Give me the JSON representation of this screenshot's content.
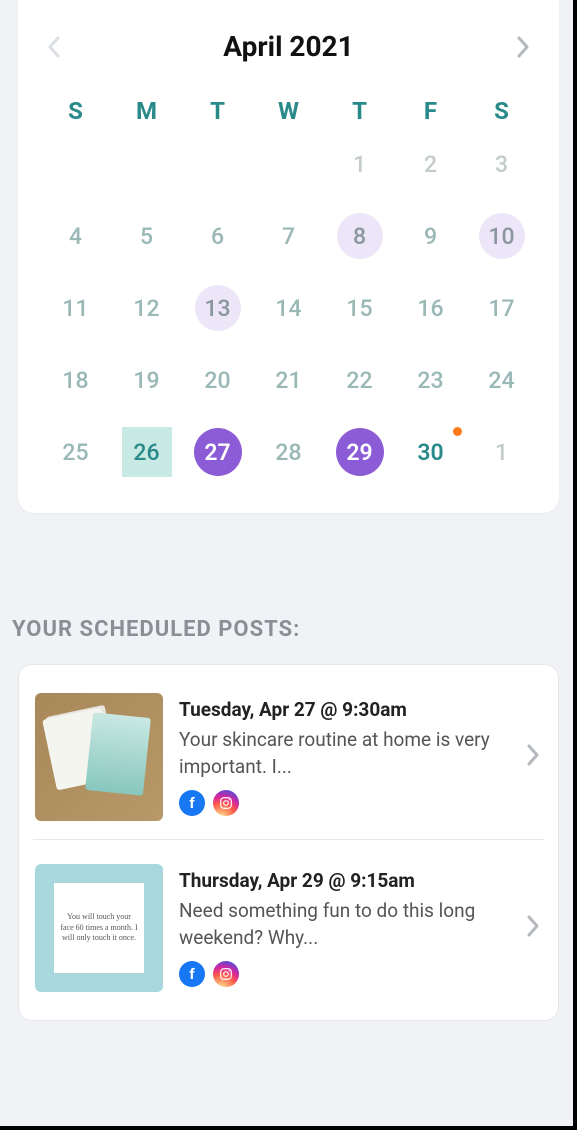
{
  "calendar": {
    "title": "April 2021",
    "weekdays": [
      "S",
      "M",
      "T",
      "W",
      "T",
      "F",
      "S"
    ],
    "cells": [
      {
        "n": "",
        "cls": ""
      },
      {
        "n": "",
        "cls": ""
      },
      {
        "n": "",
        "cls": ""
      },
      {
        "n": "",
        "cls": ""
      },
      {
        "n": "1",
        "cls": "prev-month"
      },
      {
        "n": "2",
        "cls": "prev-month"
      },
      {
        "n": "3",
        "cls": "prev-month"
      },
      {
        "n": "4",
        "cls": ""
      },
      {
        "n": "5",
        "cls": ""
      },
      {
        "n": "6",
        "cls": ""
      },
      {
        "n": "7",
        "cls": ""
      },
      {
        "n": "8",
        "cls": "light-purple"
      },
      {
        "n": "9",
        "cls": ""
      },
      {
        "n": "10",
        "cls": "light-purple"
      },
      {
        "n": "11",
        "cls": ""
      },
      {
        "n": "12",
        "cls": ""
      },
      {
        "n": "13",
        "cls": "light-purple"
      },
      {
        "n": "14",
        "cls": ""
      },
      {
        "n": "15",
        "cls": ""
      },
      {
        "n": "16",
        "cls": ""
      },
      {
        "n": "17",
        "cls": ""
      },
      {
        "n": "18",
        "cls": ""
      },
      {
        "n": "19",
        "cls": ""
      },
      {
        "n": "20",
        "cls": ""
      },
      {
        "n": "21",
        "cls": ""
      },
      {
        "n": "22",
        "cls": ""
      },
      {
        "n": "23",
        "cls": ""
      },
      {
        "n": "24",
        "cls": ""
      },
      {
        "n": "25",
        "cls": ""
      },
      {
        "n": "26",
        "cls": "selected-box"
      },
      {
        "n": "27",
        "cls": "purple"
      },
      {
        "n": "28",
        "cls": ""
      },
      {
        "n": "29",
        "cls": "purple"
      },
      {
        "n": "30",
        "cls": "today"
      },
      {
        "n": "1",
        "cls": "next-month"
      }
    ]
  },
  "section_title": "YOUR SCHEDULED POSTS:",
  "posts": [
    {
      "date": "Tuesday, Apr 27 @ 9:30am",
      "text": "Your skincare routine at home is very important. I...",
      "channels": [
        "facebook",
        "instagram"
      ],
      "thumb": "skincare"
    },
    {
      "date": "Thursday, Apr 29 @ 9:15am",
      "text": "Need something fun to do this long weekend? Why...",
      "channels": [
        "facebook",
        "instagram"
      ],
      "thumb": "quote",
      "quote": "You will touch your face 60 times a month. I will only touch it once."
    }
  ]
}
